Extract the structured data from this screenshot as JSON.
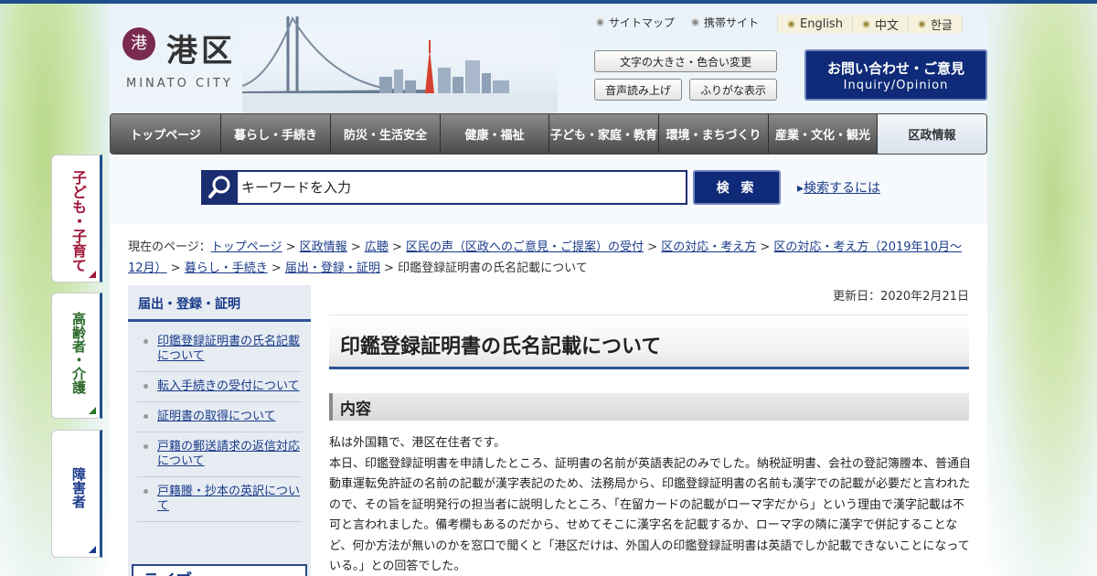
{
  "header": {
    "logo_mark": "港",
    "logo_name": "港区",
    "logo_sub": "MINATO CITY",
    "links": [
      "サイトマップ",
      "携帯サイト"
    ],
    "languages": [
      "English",
      "中文",
      "한글"
    ],
    "text_size_button": "文字の大きさ・色合い変更",
    "voice_button": "音声読み上げ",
    "furigana_button": "ふりがな表示",
    "inquiry_line1": "お問い合わせ・ご意見",
    "inquiry_line2": "Inquiry/Opinion"
  },
  "nav": [
    "トップページ",
    "暮らし・手続き",
    "防災・生活安全",
    "健康・福祉",
    "子ども・家庭・教育",
    "環境・まちづくり",
    "産業・文化・観光",
    "区政情報"
  ],
  "side_tabs": [
    "子ども・子育て",
    "高齢者・介護",
    "障害者"
  ],
  "search": {
    "placeholder": "キーワードを入力",
    "button": "検 索",
    "howto": "検索するには"
  },
  "breadcrumb": {
    "label": "現在のページ：",
    "items": [
      "トップページ",
      "区政情報",
      "広聴",
      "区民の声（区政へのご意見・ご提案）の受付",
      "区の対応・考え方",
      "区の対応・考え方（2019年10月～12月）",
      "暮らし・手続き",
      "届出・登録・証明"
    ],
    "current": "印鑑登録証明書の氏名記載について"
  },
  "sidebar": {
    "heading": "届出・登録・証明",
    "items": [
      "印鑑登録証明書の氏名記載について",
      "転入手続きの受付について",
      "証明書の取得について",
      "戸籍の郵送請求の返信対応について",
      "戸籍謄・抄本の英訳について"
    ],
    "banner": "ライブ..."
  },
  "main": {
    "updated": "更新日：2020年2月21日",
    "title": "印鑑登録証明書の氏名記載について",
    "section": "内容",
    "paragraph1": "私は外国籍で、港区在住者です。",
    "paragraph2": "本日、印鑑登録証明書を申請したところ、証明書の名前が英語表記のみでした。納税証明書、会社の登記簿謄本、普通自動車運転免許証の名前の記載が漢字表記のため、法務局から、印鑑登録証明書の名前も漢字での記載が必要だと言われたので、その旨を証明発行の担当者に説明したところ、「在留カードの記載がローマ字だから」という理由で漢字記載は不可と言われました。備考欄もあるのだから、せめてそこに漢字名を記載するか、ローマ字の隣に漢字で併記することなど、何か方法が無いのかを窓口で聞くと「港区だけは、外国人の印鑑登録証明書は英語でしか記載できないことになっている。」との回答でした。"
  },
  "colors": {
    "brand": "#1e4f8c",
    "nav_dark": "#4a4a4a",
    "button_navy": "#0e2a78",
    "link": "#1a3b8a",
    "logo": "#7a2a4e"
  }
}
